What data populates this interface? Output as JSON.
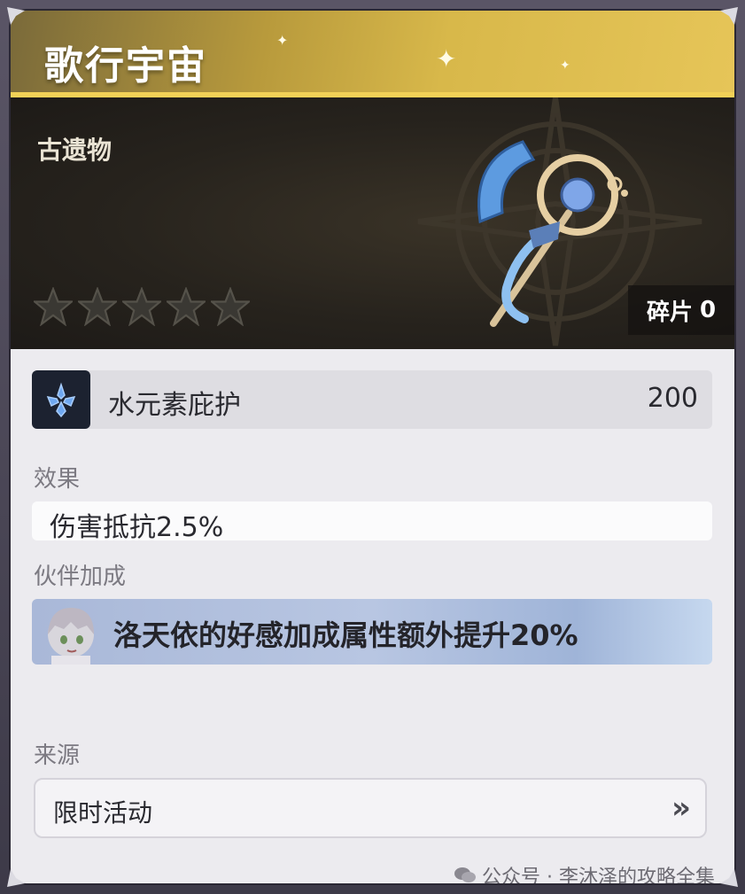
{
  "header": {
    "title": "歌行宇宙"
  },
  "banner": {
    "category": "古遗物",
    "stars_total": 5,
    "stars_filled": 0,
    "fragment_label": "碎片",
    "fragment_count": "0"
  },
  "stat": {
    "icon": "hydro-element-icon",
    "name": "水元素庇护",
    "value": "200"
  },
  "effect": {
    "label": "效果",
    "text": "伤害抵抗2.5%"
  },
  "bonus": {
    "label": "伙伴加成",
    "text": "洛天依的好感加成属性额外提升20%"
  },
  "source": {
    "label": "来源",
    "value": "限时活动",
    "arrow": "»"
  },
  "watermark": {
    "text": "公众号 · 李沐泽的攻略全集"
  },
  "colors": {
    "header_gold": "#d8b84a",
    "accent_line": "#f2d157",
    "banner_dark": "#27231d",
    "panel_bg": "#ecebef"
  }
}
